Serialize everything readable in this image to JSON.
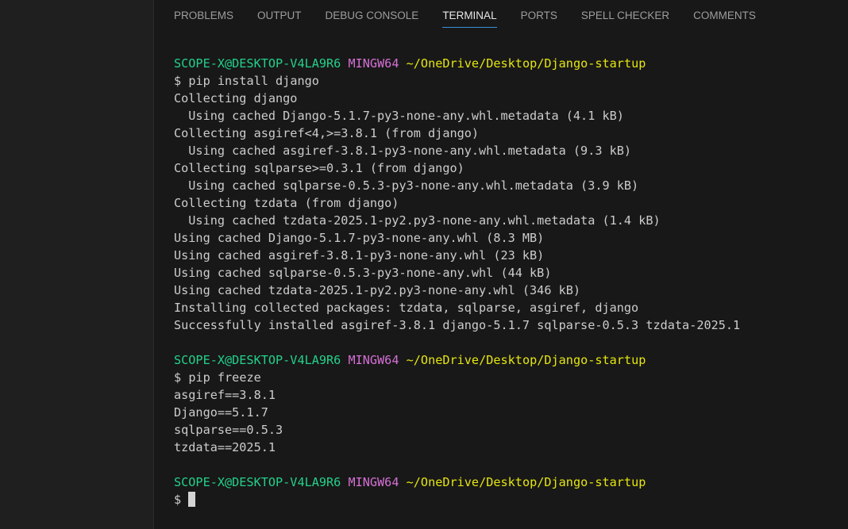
{
  "tabs": [
    {
      "label": "PROBLEMS"
    },
    {
      "label": "OUTPUT"
    },
    {
      "label": "DEBUG CONSOLE"
    },
    {
      "label": "TERMINAL",
      "active": true
    },
    {
      "label": "PORTS"
    },
    {
      "label": "SPELL CHECKER"
    },
    {
      "label": "COMMENTS"
    }
  ],
  "prompt": {
    "user_host": "SCOPE-X@DESKTOP-V4LA9R6",
    "shell": "MINGW64",
    "path": "~/OneDrive/Desktop/Django-startup",
    "symbol": "$"
  },
  "blocks": [
    {
      "command": "pip install django",
      "output": [
        "Collecting django",
        "  Using cached Django-5.1.7-py3-none-any.whl.metadata (4.1 kB)",
        "Collecting asgiref<4,>=3.8.1 (from django)",
        "  Using cached asgiref-3.8.1-py3-none-any.whl.metadata (9.3 kB)",
        "Collecting sqlparse>=0.3.1 (from django)",
        "  Using cached sqlparse-0.5.3-py3-none-any.whl.metadata (3.9 kB)",
        "Collecting tzdata (from django)",
        "  Using cached tzdata-2025.1-py2.py3-none-any.whl.metadata (1.4 kB)",
        "Using cached Django-5.1.7-py3-none-any.whl (8.3 MB)",
        "Using cached asgiref-3.8.1-py3-none-any.whl (23 kB)",
        "Using cached sqlparse-0.5.3-py3-none-any.whl (44 kB)",
        "Using cached tzdata-2025.1-py2.py3-none-any.whl (346 kB)",
        "Installing collected packages: tzdata, sqlparse, asgiref, django",
        "Successfully installed asgiref-3.8.1 django-5.1.7 sqlparse-0.5.3 tzdata-2025.1"
      ]
    },
    {
      "command": "pip freeze",
      "output": [
        "asgiref==3.8.1",
        "Django==5.1.7",
        "sqlparse==0.5.3",
        "tzdata==2025.1"
      ]
    }
  ],
  "colors": {
    "user_host": "#23d18b",
    "shell": "#d670d6",
    "path": "#e5e510",
    "text": "#cccccc",
    "active_tab_underline": "#3c8fd8"
  }
}
